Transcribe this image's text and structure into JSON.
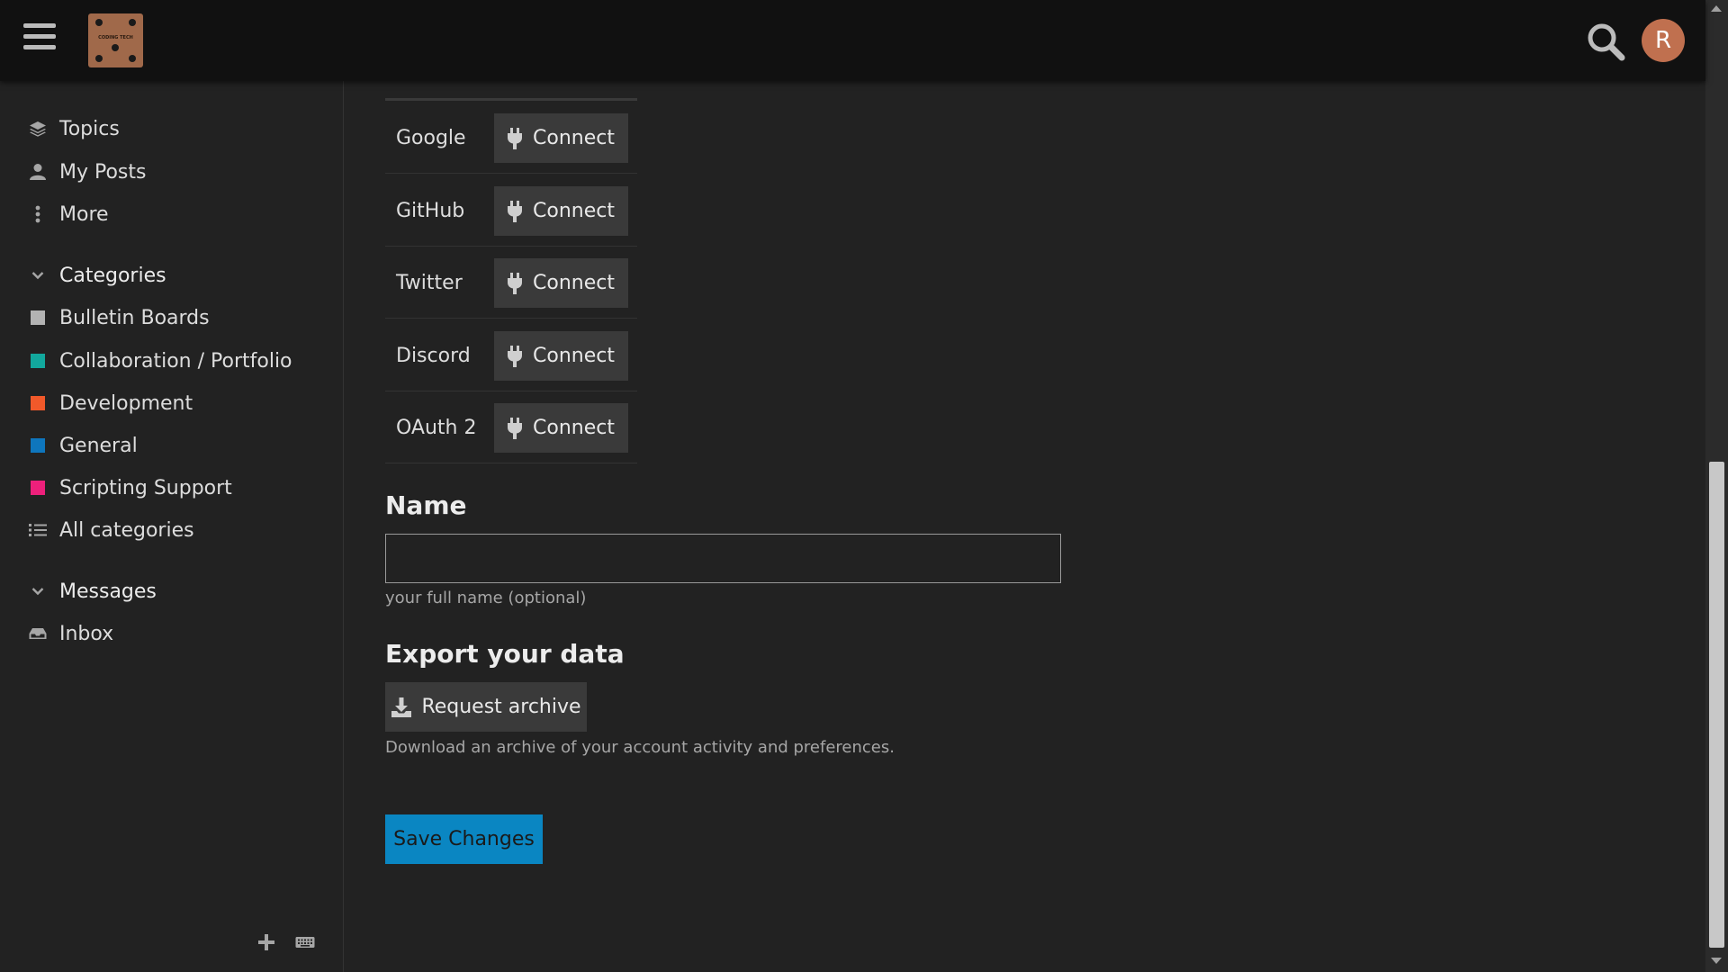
{
  "header": {
    "logo_text": "CODING TECH",
    "avatar_letter": "R"
  },
  "sidebar": {
    "nav": [
      {
        "label": "Topics",
        "icon": "layers-icon"
      },
      {
        "label": "My Posts",
        "icon": "user-icon"
      },
      {
        "label": "More",
        "icon": "vertical-dots-icon"
      }
    ],
    "categories_heading": "Categories",
    "categories": [
      {
        "label": "Bulletin Boards",
        "color": "#b3b3b3"
      },
      {
        "label": "Collaboration / Portfolio",
        "color": "#12a89d"
      },
      {
        "label": "Development",
        "color": "#f1592a"
      },
      {
        "label": "General",
        "color": "#0e76bd"
      },
      {
        "label": "Scripting Support",
        "color": "#ed207b"
      }
    ],
    "all_categories": "All categories",
    "messages_heading": "Messages",
    "inbox": "Inbox"
  },
  "accounts": [
    {
      "name": "Google",
      "button": "Connect"
    },
    {
      "name": "GitHub",
      "button": "Connect"
    },
    {
      "name": "Twitter",
      "button": "Connect"
    },
    {
      "name": "Discord",
      "button": "Connect"
    },
    {
      "name": "OAuth 2",
      "button": "Connect"
    }
  ],
  "name_section": {
    "heading": "Name",
    "value": "",
    "hint": "your full name (optional)"
  },
  "export_section": {
    "heading": "Export your data",
    "button": "Request archive",
    "description": "Download an archive of your account activity and preferences."
  },
  "save_button": "Save Changes"
}
